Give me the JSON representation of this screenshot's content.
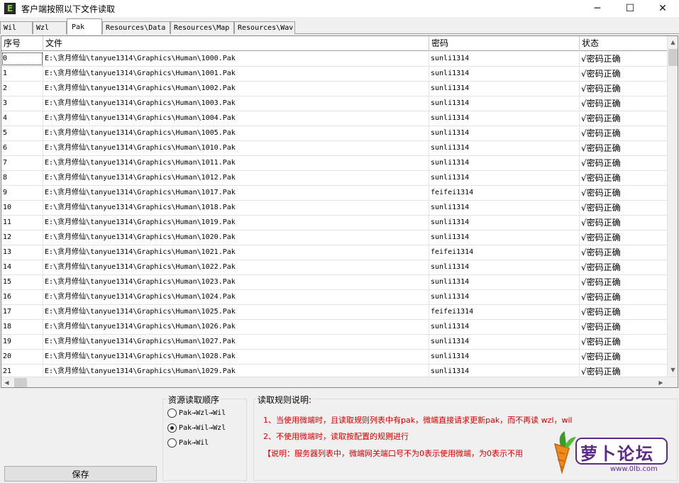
{
  "window": {
    "title": "客户端按照以下文件读取",
    "app_icon_letter": "E",
    "minimize": "─",
    "maximize": "☐",
    "close": "✕"
  },
  "tabs": [
    {
      "label": "Wil",
      "active": false
    },
    {
      "label": "Wzl",
      "active": false
    },
    {
      "label": "Pak",
      "active": true
    },
    {
      "label": "Resources\\Data",
      "active": false
    },
    {
      "label": "Resources\\Map",
      "active": false
    },
    {
      "label": "Resources\\Wav",
      "active": false
    }
  ],
  "table": {
    "columns": [
      "序号",
      "文件",
      "密码",
      "状态"
    ],
    "rows": [
      [
        "0",
        "E:\\贪月修仙\\tanyue1314\\Graphics\\Human\\1000.Pak",
        "sunli1314",
        "√密码正确"
      ],
      [
        "1",
        "E:\\贪月修仙\\tanyue1314\\Graphics\\Human\\1001.Pak",
        "sunli1314",
        "√密码正确"
      ],
      [
        "2",
        "E:\\贪月修仙\\tanyue1314\\Graphics\\Human\\1002.Pak",
        "sunli1314",
        "√密码正确"
      ],
      [
        "3",
        "E:\\贪月修仙\\tanyue1314\\Graphics\\Human\\1003.Pak",
        "sunli1314",
        "√密码正确"
      ],
      [
        "4",
        "E:\\贪月修仙\\tanyue1314\\Graphics\\Human\\1004.Pak",
        "sunli1314",
        "√密码正确"
      ],
      [
        "5",
        "E:\\贪月修仙\\tanyue1314\\Graphics\\Human\\1005.Pak",
        "sunli1314",
        "√密码正确"
      ],
      [
        "6",
        "E:\\贪月修仙\\tanyue1314\\Graphics\\Human\\1010.Pak",
        "sunli1314",
        "√密码正确"
      ],
      [
        "7",
        "E:\\贪月修仙\\tanyue1314\\Graphics\\Human\\1011.Pak",
        "sunli1314",
        "√密码正确"
      ],
      [
        "8",
        "E:\\贪月修仙\\tanyue1314\\Graphics\\Human\\1012.Pak",
        "sunli1314",
        "√密码正确"
      ],
      [
        "9",
        "E:\\贪月修仙\\tanyue1314\\Graphics\\Human\\1017.Pak",
        "feifei1314",
        "√密码正确"
      ],
      [
        "10",
        "E:\\贪月修仙\\tanyue1314\\Graphics\\Human\\1018.Pak",
        "sunli1314",
        "√密码正确"
      ],
      [
        "11",
        "E:\\贪月修仙\\tanyue1314\\Graphics\\Human\\1019.Pak",
        "sunli1314",
        "√密码正确"
      ],
      [
        "12",
        "E:\\贪月修仙\\tanyue1314\\Graphics\\Human\\1020.Pak",
        "sunli1314",
        "√密码正确"
      ],
      [
        "13",
        "E:\\贪月修仙\\tanyue1314\\Graphics\\Human\\1021.Pak",
        "feifei1314",
        "√密码正确"
      ],
      [
        "14",
        "E:\\贪月修仙\\tanyue1314\\Graphics\\Human\\1022.Pak",
        "sunli1314",
        "√密码正确"
      ],
      [
        "15",
        "E:\\贪月修仙\\tanyue1314\\Graphics\\Human\\1023.Pak",
        "sunli1314",
        "√密码正确"
      ],
      [
        "16",
        "E:\\贪月修仙\\tanyue1314\\Graphics\\Human\\1024.Pak",
        "sunli1314",
        "√密码正确"
      ],
      [
        "17",
        "E:\\贪月修仙\\tanyue1314\\Graphics\\Human\\1025.Pak",
        "feifei1314",
        "√密码正确"
      ],
      [
        "18",
        "E:\\贪月修仙\\tanyue1314\\Graphics\\Human\\1026.Pak",
        "sunli1314",
        "√密码正确"
      ],
      [
        "19",
        "E:\\贪月修仙\\tanyue1314\\Graphics\\Human\\1027.Pak",
        "sunli1314",
        "√密码正确"
      ],
      [
        "20",
        "E:\\贪月修仙\\tanyue1314\\Graphics\\Human\\1028.Pak",
        "sunli1314",
        "√密码正确"
      ],
      [
        "21",
        "E:\\贪月修仙\\tanyue1314\\Graphics\\Human\\1029.Pak",
        "sunli1314",
        "√密码正确"
      ]
    ]
  },
  "scrollbars": {
    "up": "▲",
    "down": "▼",
    "left": "◀",
    "right": "▶"
  },
  "bottom": {
    "save_label": "保存",
    "order_legend": "资源读取顺序",
    "order_options": [
      {
        "label": "Pak→Wzl→Wil",
        "checked": false
      },
      {
        "label": "Pak→Wil→Wzl",
        "checked": true
      },
      {
        "label": "Pak→Wil",
        "checked": false
      }
    ],
    "rules_legend": "读取规则说明:",
    "rules": [
      "1、当使用微端时，且读取规则列表中有pak，微端直接请求更新pak，而不再读 wzl，wil",
      "2、不使用微端时，读取按配置的规则进行",
      "【说明：服务器列表中，微端网关端口号不为0表示使用微端，为0表示不用"
    ]
  },
  "watermark": {
    "text": "萝卜论坛",
    "url": "www.0lb.com"
  },
  "colors": {
    "rule_text": "#d40000",
    "logo_orange": "#f08a1c",
    "logo_purple": "#5b2a86"
  }
}
